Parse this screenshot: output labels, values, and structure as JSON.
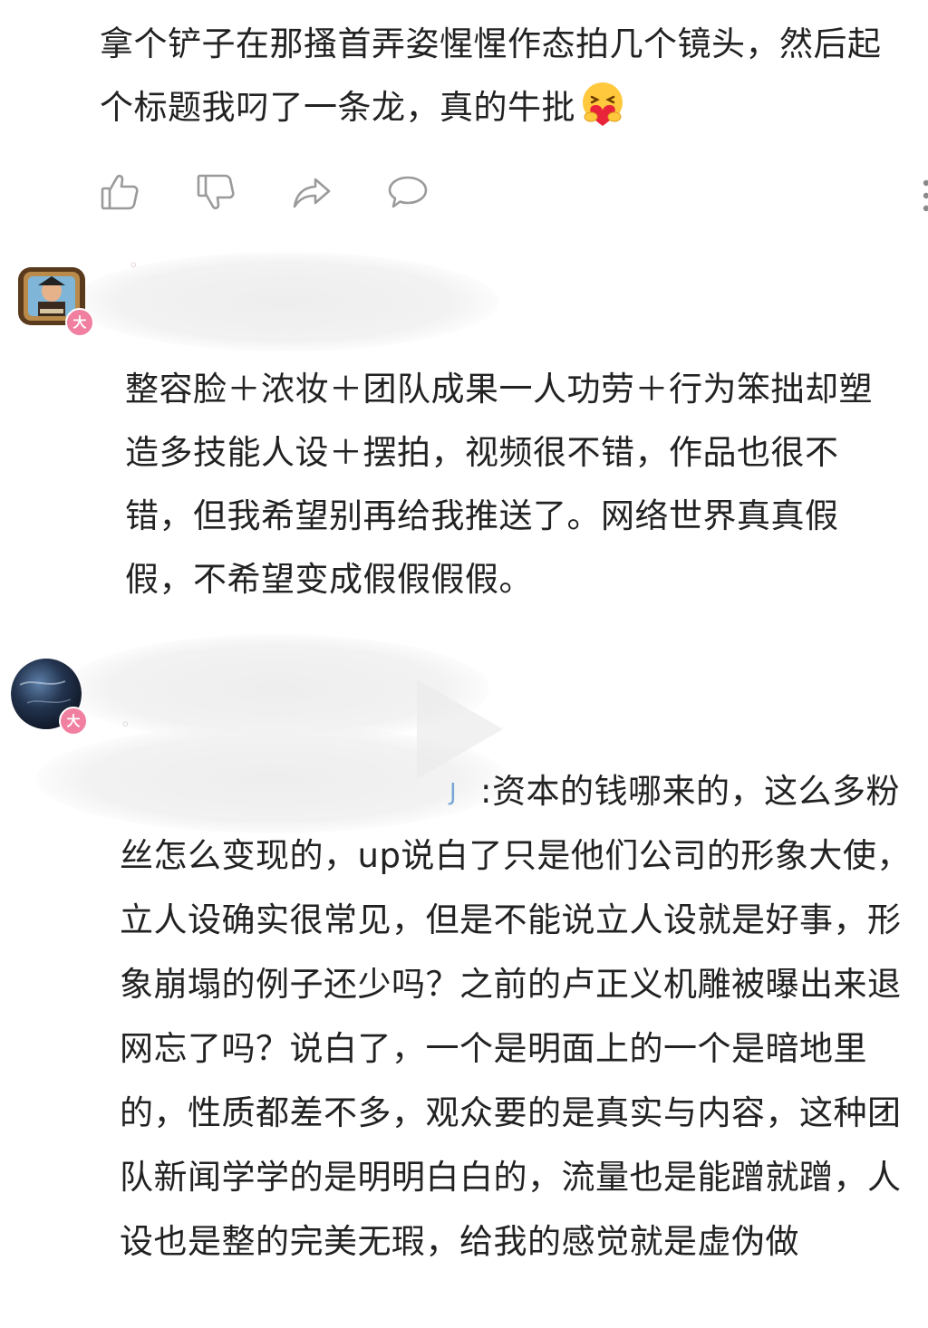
{
  "top_comment": {
    "text": "拿个铲子在那搔首弄姿惺惺作态拍几个镜头，然后起个标题我叼了一条龙，真的牛批",
    "emoji_icon": "hug-heart-emoji"
  },
  "actions": {
    "like_icon": "thumbs-up-icon",
    "dislike_icon": "thumbs-down-icon",
    "share_icon": "share-arrow-icon",
    "reply_icon": "comment-bubble-icon",
    "more_icon": "more-vertical-icon"
  },
  "comment_2": {
    "badge": "大",
    "text": "整容脸＋浓妆＋团队成果一人功劳＋行为笨拙却塑造多技能人设＋摆拍，视频很不错，作品也很不错，但我希望别再给我推送了。网络世界真真假假，不希望变成假假假假。"
  },
  "comment_3": {
    "badge": "大",
    "text": ":资本的钱哪来的，这么多粉丝怎么变现的，up说白了只是他们公司的形象大使，立人设确实很常见，但是不能说立人设就是好事，形象崩塌的例子还少吗？之前的卢正义机雕被曝出来退网忘了吗？说白了，一个是明面上的一个是暗地里的，性质都差不多，观众要的是真实与内容，这种团队新闻学学的是明明白白的，流量也是能蹭就蹭，人设也是整的完美无瑕，给我的感觉就是虚伪做"
  },
  "colors": {
    "text": "#222222",
    "icon": "#9a9a9a",
    "badge": "#f17fa0"
  }
}
